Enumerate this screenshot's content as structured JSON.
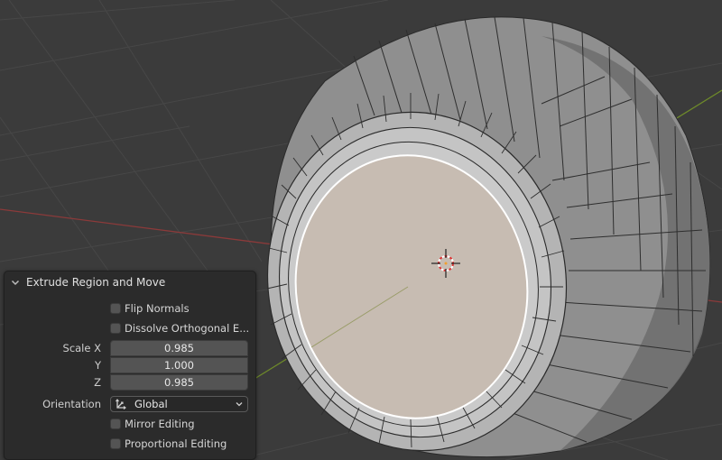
{
  "operator_panel": {
    "title": "Extrude Region and Move",
    "flip_normals": {
      "label": "Flip Normals",
      "checked": false
    },
    "dissolve_orthogonal": {
      "label": "Dissolve Orthogonal E...",
      "checked": false
    },
    "scale": {
      "x_label": "Scale X",
      "x_value": "0.985",
      "y_label": "Y",
      "y_value": "1.000",
      "z_label": "Z",
      "z_value": "0.985"
    },
    "orientation": {
      "label": "Orientation",
      "value": "Global",
      "icon": "transform-orientation-icon"
    },
    "mirror_editing": {
      "label": "Mirror Editing",
      "checked": false
    },
    "proportional_editing": {
      "label": "Proportional Editing",
      "checked": false
    }
  },
  "colors": {
    "viewport_bg": "#3a3a3a",
    "grid_line": "#444444",
    "x_axis": "#8b3a3a",
    "y_axis": "#6e8a2a",
    "selected_face": "#c8bdb3",
    "mesh_face": "#9a9a9a",
    "wire": "#2a2a2a"
  }
}
